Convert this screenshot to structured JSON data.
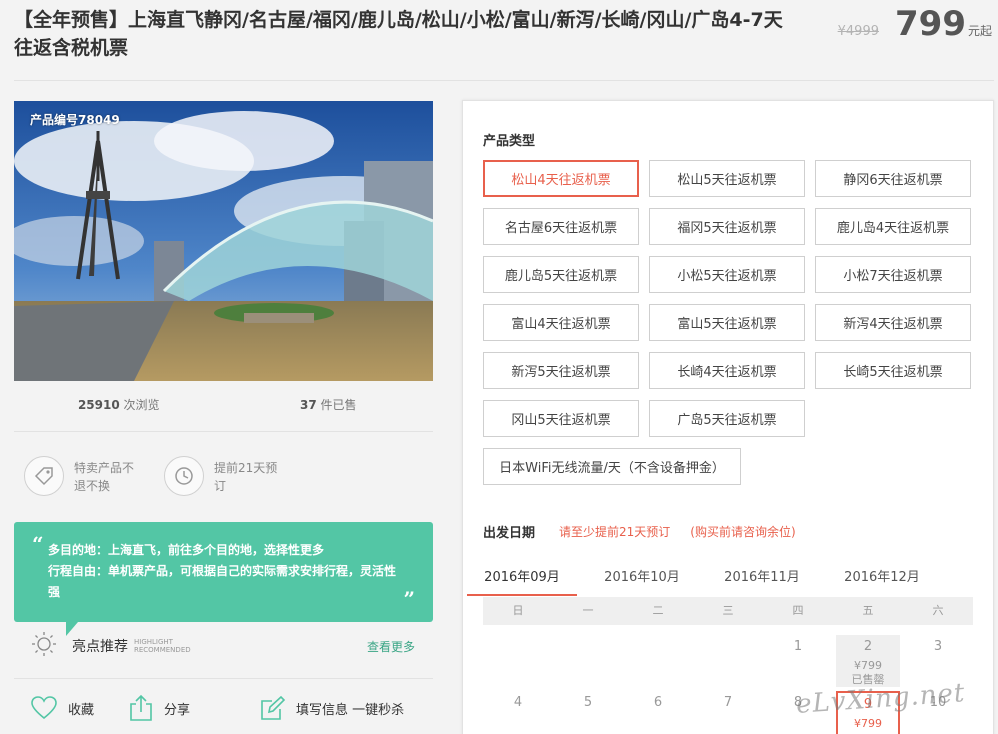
{
  "product": {
    "title": "【全年预售】上海直飞静冈/名古屋/福冈/鹿儿岛/松山/小松/富山/新泻/长崎/冈山/广岛4-7天往返含税机票",
    "old_price": "¥4999",
    "price": "799",
    "price_unit": "元起",
    "product_no": "产品编号78049"
  },
  "stats": {
    "views": "25910",
    "views_label": "次浏览",
    "sold": "37",
    "sold_label": "件已售"
  },
  "policies": [
    {
      "icon": "tag-icon",
      "text": "特卖产品不退不换"
    },
    {
      "icon": "clock-icon",
      "text": "提前21天预订"
    }
  ],
  "intro": {
    "line1": "多目的地：上海直飞，前往多个目的地，选择性更多",
    "line2": "行程自由：单机票产品，可根据自己的实际需求安排行程，灵活性强"
  },
  "highlight": {
    "title": "亮点推荐",
    "sub": "HIGHLIGHT RECOMMENDED",
    "more": "查看更多"
  },
  "actions": {
    "favorite": "收藏",
    "share": "分享",
    "fill": "填写信息 一键秒杀"
  },
  "panel": {
    "type_label": "产品类型",
    "options": [
      "松山4天往返机票",
      "松山5天往返机票",
      "静冈6天往返机票",
      "名古屋6天往返机票",
      "福冈5天往返机票",
      "鹿儿岛4天往返机票",
      "鹿儿岛5天往返机票",
      "小松5天往返机票",
      "小松7天往返机票",
      "富山4天往返机票",
      "富山5天往返机票",
      "新泻4天往返机票",
      "新泻5天往返机票",
      "长崎4天往返机票",
      "长崎5天往返机票",
      "冈山5天往返机票",
      "广岛5天往返机票",
      "日本WiFi无线流量/天（不含设备押金）"
    ],
    "selected_option": 0,
    "date_label": "出发日期",
    "date_note_1": "请至少提前21天预订",
    "date_note_2": "(购买前请咨询余位)",
    "months": [
      "2016年09月",
      "2016年10月",
      "2016年11月",
      "2016年12月"
    ],
    "selected_month": 0,
    "weekdays": [
      "日",
      "一",
      "二",
      "三",
      "四",
      "五",
      "六"
    ],
    "days_row1": [
      "1",
      "2",
      "3"
    ],
    "days_row2": [
      "4",
      "5",
      "6",
      "7",
      "8",
      "9",
      "10"
    ],
    "day2_price": "¥799",
    "day2_status": "已售罄",
    "day9_price": "¥799"
  },
  "watermark": "eLvXing.net"
}
